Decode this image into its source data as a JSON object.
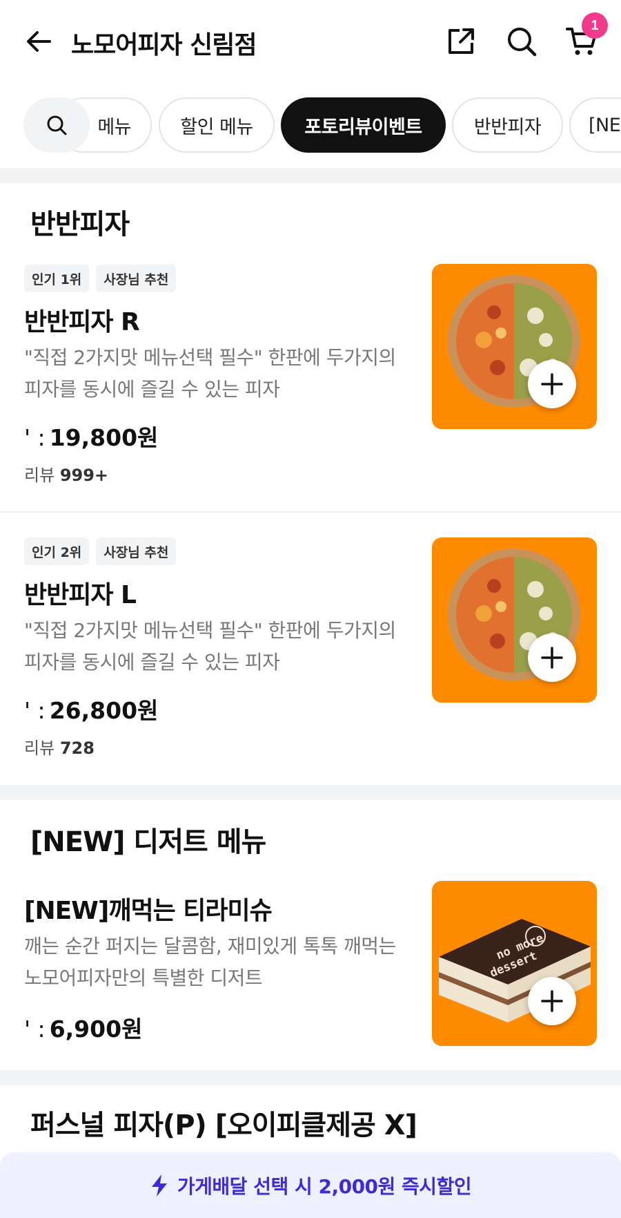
{
  "header": {
    "title": "노모어피자 신림점",
    "cart_count": "1"
  },
  "chips": [
    {
      "label": "메뉴"
    },
    {
      "label": "할인 메뉴"
    },
    {
      "label": "포토리뷰이벤트",
      "active": true
    },
    {
      "label": "반반피자"
    },
    {
      "label": "[NE"
    }
  ],
  "sections": [
    {
      "title": "반반피자",
      "items": [
        {
          "badges": [
            "인기 1위",
            "사장님 추천"
          ],
          "name": "반반피자 R",
          "desc": "\"직접 2가지맛 메뉴선택 필수\" 한판에 두가지의 피자를 동시에 즐길 수 있는 피자",
          "price_prefix": "' :",
          "price": "19,800원",
          "review_label": "리뷰",
          "review_count": "999+"
        },
        {
          "badges": [
            "인기 2위",
            "사장님 추천"
          ],
          "name": "반반피자 L",
          "desc": "\"직접 2가지맛 메뉴선택 필수\" 한판에 두가지의 피자를 동시에 즐길 수 있는 피자",
          "price_prefix": "' :",
          "price": "26,800원",
          "review_label": "리뷰",
          "review_count": "728"
        }
      ]
    },
    {
      "title": "[NEW] 디저트 메뉴",
      "items": [
        {
          "name": "[NEW]깨먹는 티라미슈",
          "desc": "깨는 순간 퍼지는 달콤함, 재미있게 톡톡 깨먹는 노모어피자만의 특별한 디저트",
          "price_prefix": "' :",
          "price": "6,900원",
          "image_text_1": "no more",
          "image_text_2": "dessert"
        }
      ]
    },
    {
      "title": "퍼스널 피자(P) [오이피클제공 X]"
    }
  ],
  "promo": {
    "text": "가게배달 선택 시 2,000원 즉시할인"
  },
  "colors": {
    "accent_pink": "#f23a8c",
    "thumb_orange": "#ff8c00",
    "promo_bg": "#eef0ff",
    "promo_text": "#3d2bd6"
  }
}
